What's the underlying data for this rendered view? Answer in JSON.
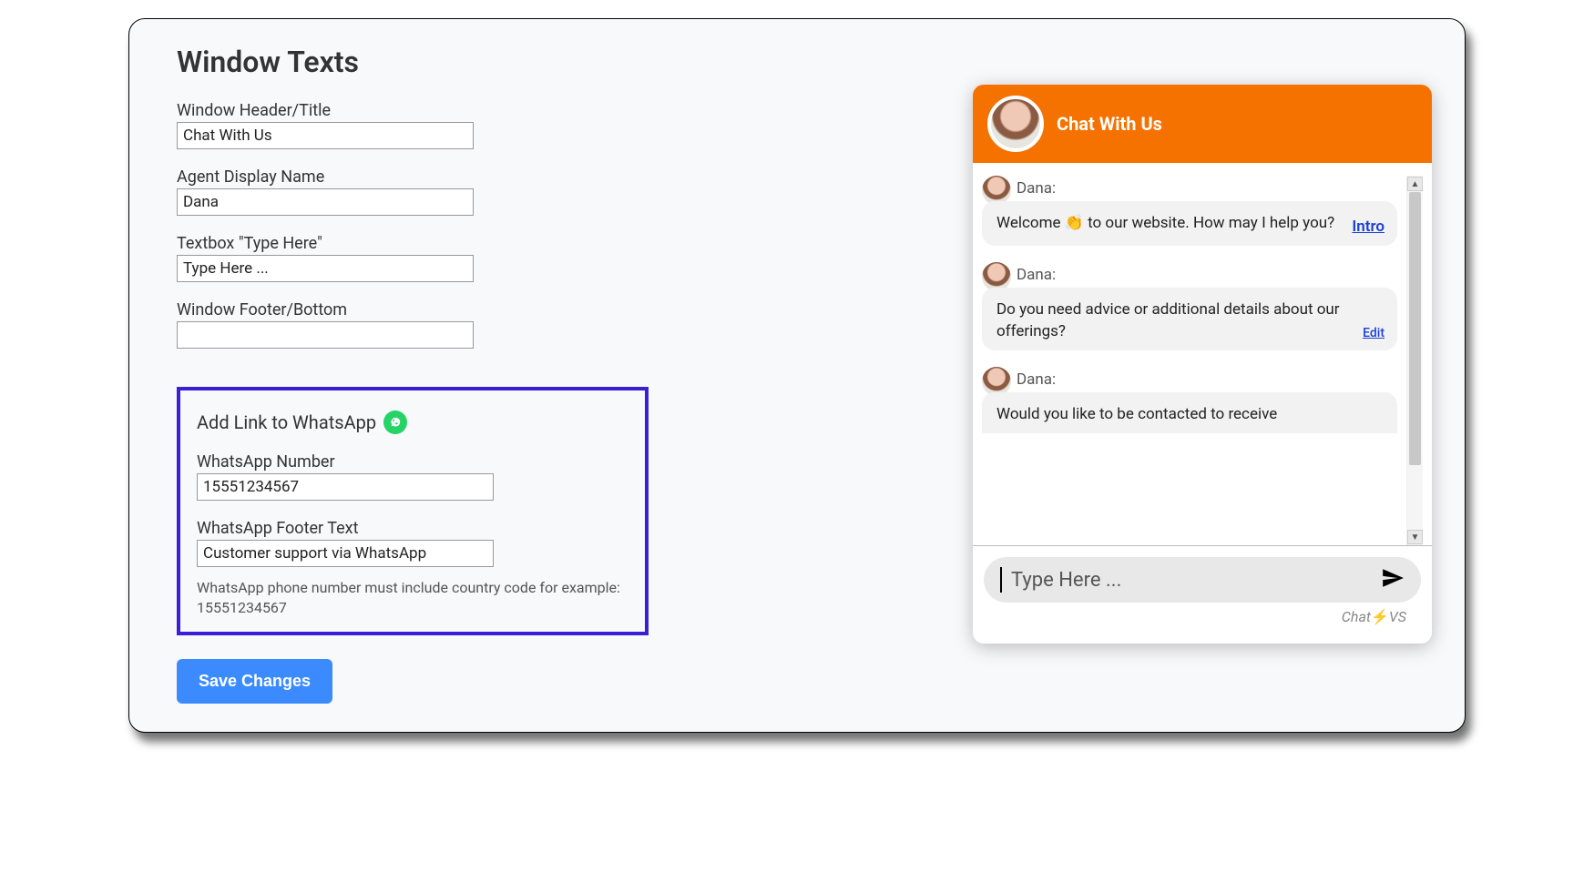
{
  "page": {
    "title": "Window Texts"
  },
  "form": {
    "window_header": {
      "label": "Window Header/Title",
      "value": "Chat With Us"
    },
    "agent_display_name": {
      "label": "Agent Display Name",
      "value": "Dana"
    },
    "textbox_placeholder": {
      "label": "Textbox \"Type Here\"",
      "value": "Type Here ..."
    },
    "window_footer": {
      "label": "Window Footer/Bottom",
      "value": ""
    }
  },
  "whatsapp": {
    "heading": "Add Link to WhatsApp",
    "number": {
      "label": "WhatsApp Number",
      "value": "15551234567"
    },
    "footer_text": {
      "label": "WhatsApp Footer Text",
      "value": "Customer support via WhatsApp"
    },
    "hint": "WhatsApp phone number must include country code for example: 15551234567"
  },
  "actions": {
    "save_label": "Save Changes"
  },
  "chat": {
    "header_title": "Chat With Us",
    "input_placeholder": "Type Here ...",
    "brand_prefix": "Chat",
    "brand_suffix": "VS",
    "messages": [
      {
        "author": "Dana:",
        "text": "Welcome 👏 to our website. How may I help you?",
        "action": "Intro"
      },
      {
        "author": "Dana:",
        "text": "Do you need advice or additional details about our offerings?",
        "action": "Edit"
      },
      {
        "author": "Dana:",
        "text": "Would you like to be contacted to receive",
        "action": ""
      }
    ]
  }
}
